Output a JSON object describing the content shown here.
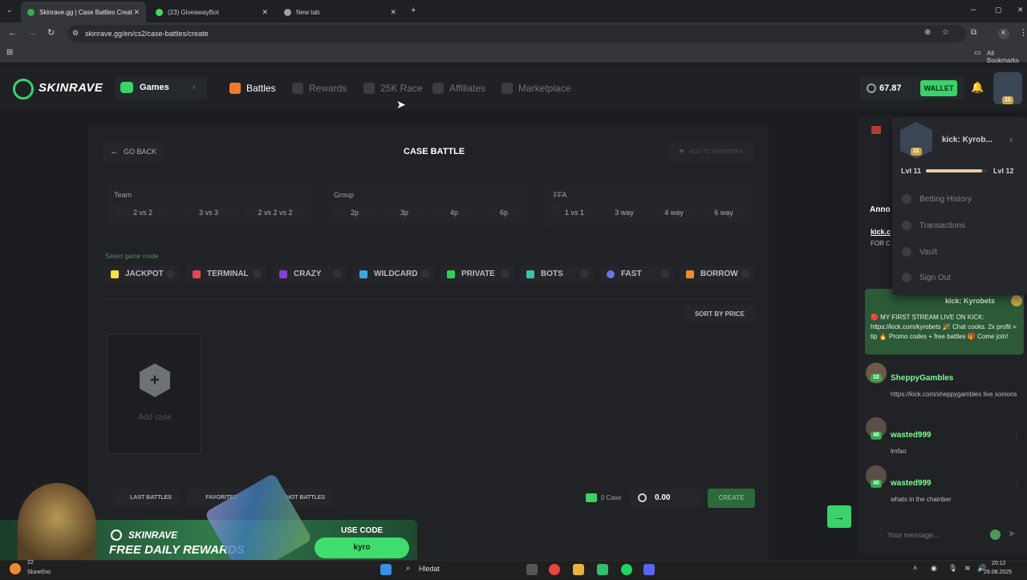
{
  "browser": {
    "tabs": [
      {
        "title": "Skinrave.gg | Case Battles Creat",
        "color": "#2fb34a"
      },
      {
        "title": "(23) GiveawayBot",
        "color": "#3ee05a"
      },
      {
        "title": "New tab",
        "color": "#9aa0a6"
      }
    ],
    "url": "skinrave.gg/en/cs2/case-battles/create",
    "profile_initial": "K",
    "all_bookmarks": "All Bookmarks"
  },
  "header": {
    "logo": "SKINRAVE",
    "games_label": "Games",
    "nav": [
      "Battles",
      "Rewards",
      "25K Race",
      "Affiliates",
      "Marketplace"
    ],
    "balance": "67.87",
    "wallet_label": "WALLET",
    "avatar_level": "11"
  },
  "battle": {
    "go_back": "GO BACK",
    "title": "CASE BATTLE",
    "favorites": "ADD TO FAVORITES",
    "team_label": "Team",
    "team_options": [
      "2 vs 2",
      "3 vs 3",
      "2 vs 2 vs 2"
    ],
    "group_label": "Group",
    "group_options": [
      "2p",
      "3p",
      "4p",
      "6p"
    ],
    "ffa_label": "FFA",
    "ffa_options": [
      "1 vs 1",
      "3 way",
      "4 way",
      "6 way"
    ],
    "mode_label": "Select game mode",
    "modes": [
      {
        "label": "JACKPOT",
        "color": "#f5e43a"
      },
      {
        "label": "TERMINAL",
        "color": "#e0484d"
      },
      {
        "label": "CRAZY",
        "color": "#8a3bd9"
      },
      {
        "label": "WILDCARD",
        "color": "#3aa8e0"
      },
      {
        "label": "PRIVATE",
        "color": "#2fd34f"
      },
      {
        "label": "BOTS",
        "color": "#34c7a6"
      },
      {
        "label": "FAST",
        "color": "#6b73e6"
      },
      {
        "label": "BORROW",
        "color": "#f08a2a"
      }
    ],
    "sort_label": "SORT BY PRICE",
    "add_case": "Add case",
    "add_plus": "+",
    "footer_tabs": [
      "LAST BATTLES",
      "FAVORITES",
      "HOT BATTLES"
    ],
    "case_count": "0 Case",
    "total": "0.00",
    "create_label": "CREATE"
  },
  "dropdown": {
    "name": "kick: Kyrob...",
    "level": "11",
    "lvl_from": "Lvl 11",
    "lvl_to": "Lvl 12",
    "progress": 0.92,
    "items": [
      "Betting History",
      "Transactions",
      "Vault",
      "Sign Out"
    ]
  },
  "chat": {
    "pinned_prefix": "Anno",
    "pinned_link": "kick.c",
    "pinned_sub": "FOR C",
    "highlight_name": "kick: Kyrobets",
    "highlight_text": "🔴 MY FIRST STREAM LIVE ON KICK: https://kick.com/kyrobets 🎉 Chat cooks. 2x profit = tip 🔥 Promo codes + free battles 🎁 Come join!",
    "messages": [
      {
        "name": "SheppyGambles",
        "level": "32",
        "text": "https://kick.com/sheppygambles live sonions"
      },
      {
        "name": "wasted999",
        "level": "40",
        "text": "lmfao"
      },
      {
        "name": "wasted999",
        "level": "40",
        "text": "whats in the chainber"
      }
    ],
    "input_placeholder": "Your message..."
  },
  "promo": {
    "brand": "SKINRAVE",
    "headline": "FREE DAILY REWARDS",
    "use_code": "USE CODE",
    "code": "kyro"
  },
  "taskbar": {
    "weather": "Slunečno",
    "temp": "22",
    "search": "Hledat",
    "time": "20:12",
    "date": "29.08.2025"
  }
}
